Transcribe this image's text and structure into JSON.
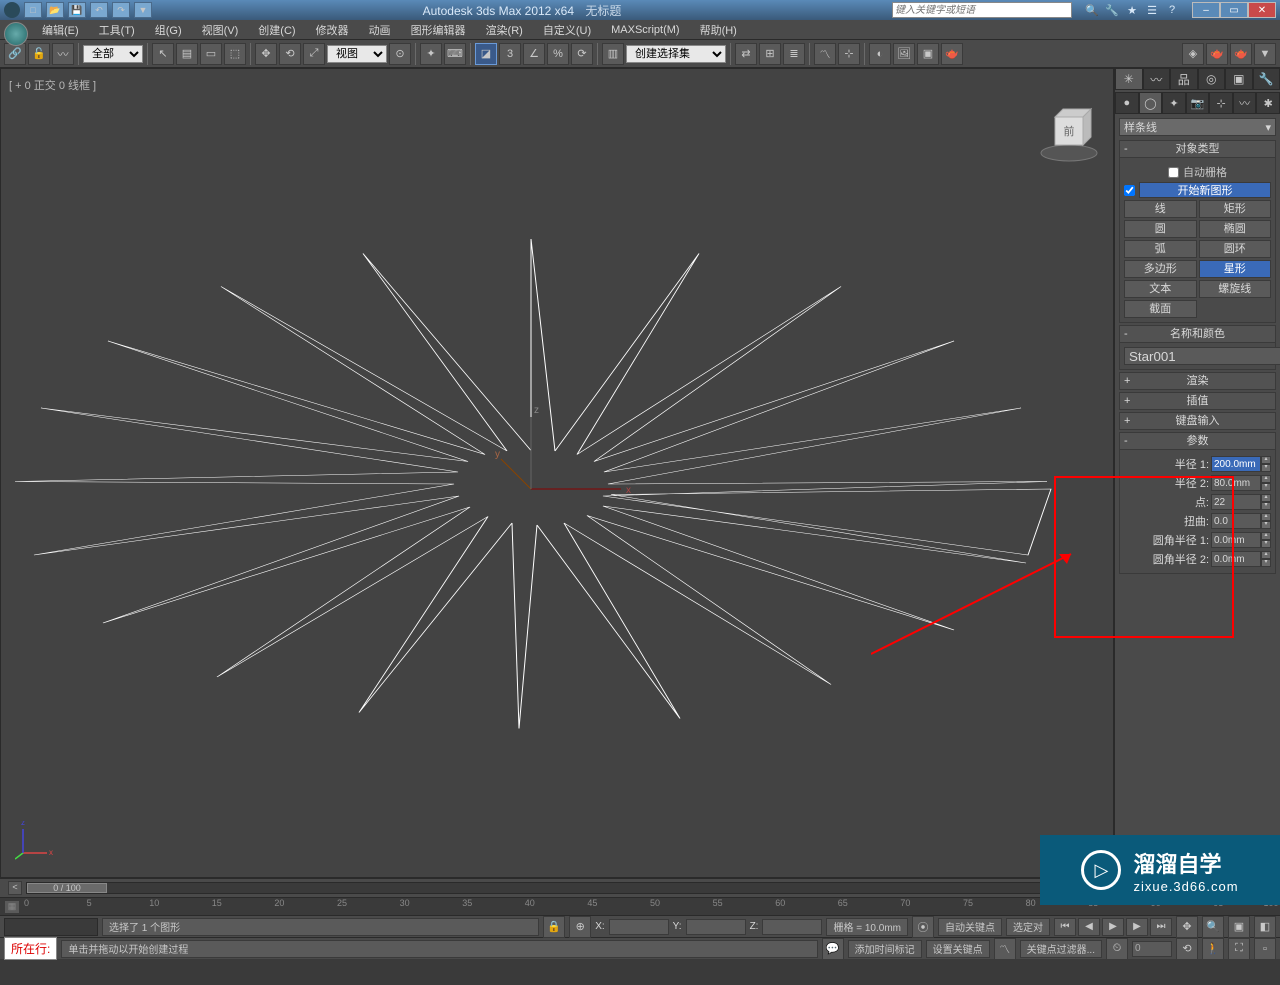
{
  "title": {
    "app": "Autodesk 3ds Max  2012 x64",
    "doc": "无标题"
  },
  "search_placeholder": "键入关键字或短语",
  "menu": [
    "编辑(E)",
    "工具(T)",
    "组(G)",
    "视图(V)",
    "创建(C)",
    "修改器",
    "动画",
    "图形编辑器",
    "渲染(R)",
    "自定义(U)",
    "MAXScript(M)",
    "帮助(H)"
  ],
  "toolbar": {
    "combo_all": "全部",
    "combo_view": "视图",
    "named_sel": "创建选择集"
  },
  "viewport": {
    "label": "[ + 0 正交 0 线框 ]",
    "axes": {
      "x": "x",
      "y": "y",
      "z": "z"
    },
    "cube": "前"
  },
  "cmdpanel": {
    "dropdown": "样条线",
    "rollouts": {
      "obj_type": {
        "title": "对象类型",
        "autogrid": "自动栅格",
        "newshape": "开始新图形",
        "buttons": [
          "线",
          "矩形",
          "圆",
          "椭圆",
          "弧",
          "圆环",
          "多边形",
          "星形",
          "文本",
          "螺旋线",
          "截面"
        ]
      },
      "name_color": {
        "title": "名称和颜色",
        "name": "Star001"
      },
      "render": "渲染",
      "interp": "插值",
      "keyboard": "键盘输入",
      "params": {
        "title": "参数",
        "radius1": {
          "label": "半径 1:",
          "value": "200.0mm"
        },
        "radius2": {
          "label": "半径 2:",
          "value": "80.0mm"
        },
        "points": {
          "label": "点:",
          "value": "22"
        },
        "distort": {
          "label": "扭曲:",
          "value": "0.0"
        },
        "fillet1": {
          "label": "圆角半径 1:",
          "value": "0.0mm"
        },
        "fillet2": {
          "label": "圆角半径 2:",
          "value": "0.0mm"
        }
      }
    }
  },
  "timeline": {
    "pos": "0 / 100",
    "ticks": [
      "0",
      "5",
      "10",
      "15",
      "20",
      "25",
      "30",
      "35",
      "40",
      "45",
      "50",
      "55",
      "60",
      "65",
      "70",
      "75",
      "80",
      "85",
      "90",
      "95",
      "100"
    ]
  },
  "status": {
    "sel": "选择了 1 个图形",
    "prompt": "单击并拖动以开始创建过程",
    "grid": "栅格 = 10.0mm",
    "x": "X:",
    "y": "Y:",
    "z": "Z:",
    "autokey": "自动关键点",
    "setkey": "设置关键点",
    "selsetlabel": "选定对",
    "keyfilter": "关键点过滤器...",
    "addtime": "添加时间标记",
    "framepos": "0",
    "script": "所在行:"
  },
  "watermark": {
    "cn": "溜溜自学",
    "en": "zixue.3d66.com",
    "play": "▷"
  }
}
